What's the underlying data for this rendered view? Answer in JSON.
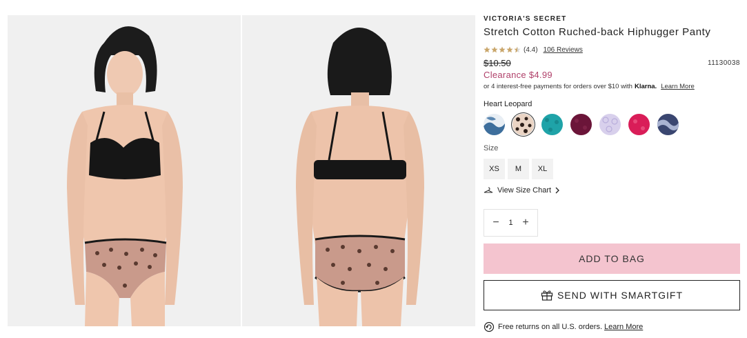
{
  "product": {
    "brand": "VICTORIA'S SECRET",
    "title": "Stretch Cotton Ruched-back Hiphugger Panty",
    "rating": "(4.4)",
    "reviews_link": "106 Reviews",
    "original_price": "$10.50",
    "sku": "11130038",
    "clearance_price": "Clearance $4.99",
    "klarna_text": "or 4 interest-free payments for orders over $10 with",
    "klarna_brand": "Klarna.",
    "klarna_link": "Learn More"
  },
  "color": {
    "selected_name": "Heart Leopard",
    "swatches": [
      {
        "name": "blue-tie-dye",
        "color": "#5a86b0"
      },
      {
        "name": "heart-leopard",
        "color": "#e8d0c0"
      },
      {
        "name": "teal",
        "color": "#1fa3a8"
      },
      {
        "name": "plum",
        "color": "#6b1539"
      },
      {
        "name": "lavender-lace",
        "color": "#cfc6e6"
      },
      {
        "name": "hot-pink",
        "color": "#d91d58"
      },
      {
        "name": "navy-tie-dye",
        "color": "#3a4670"
      }
    ]
  },
  "size": {
    "label": "Size",
    "options": [
      "XS",
      "M",
      "XL"
    ],
    "chart_link": "View Size Chart"
  },
  "quantity": {
    "minus": "−",
    "value": "1",
    "plus": "+"
  },
  "actions": {
    "add_to_bag": "ADD TO BAG",
    "smartgift": "SEND WITH SMARTGIFT"
  },
  "returns": {
    "text": "Free returns on all U.S. orders.",
    "link": "Learn More"
  },
  "colors": {
    "accent_pink": "#f4c4cf",
    "clearance_red": "#b0416a",
    "star_gold": "#c9a66b"
  }
}
